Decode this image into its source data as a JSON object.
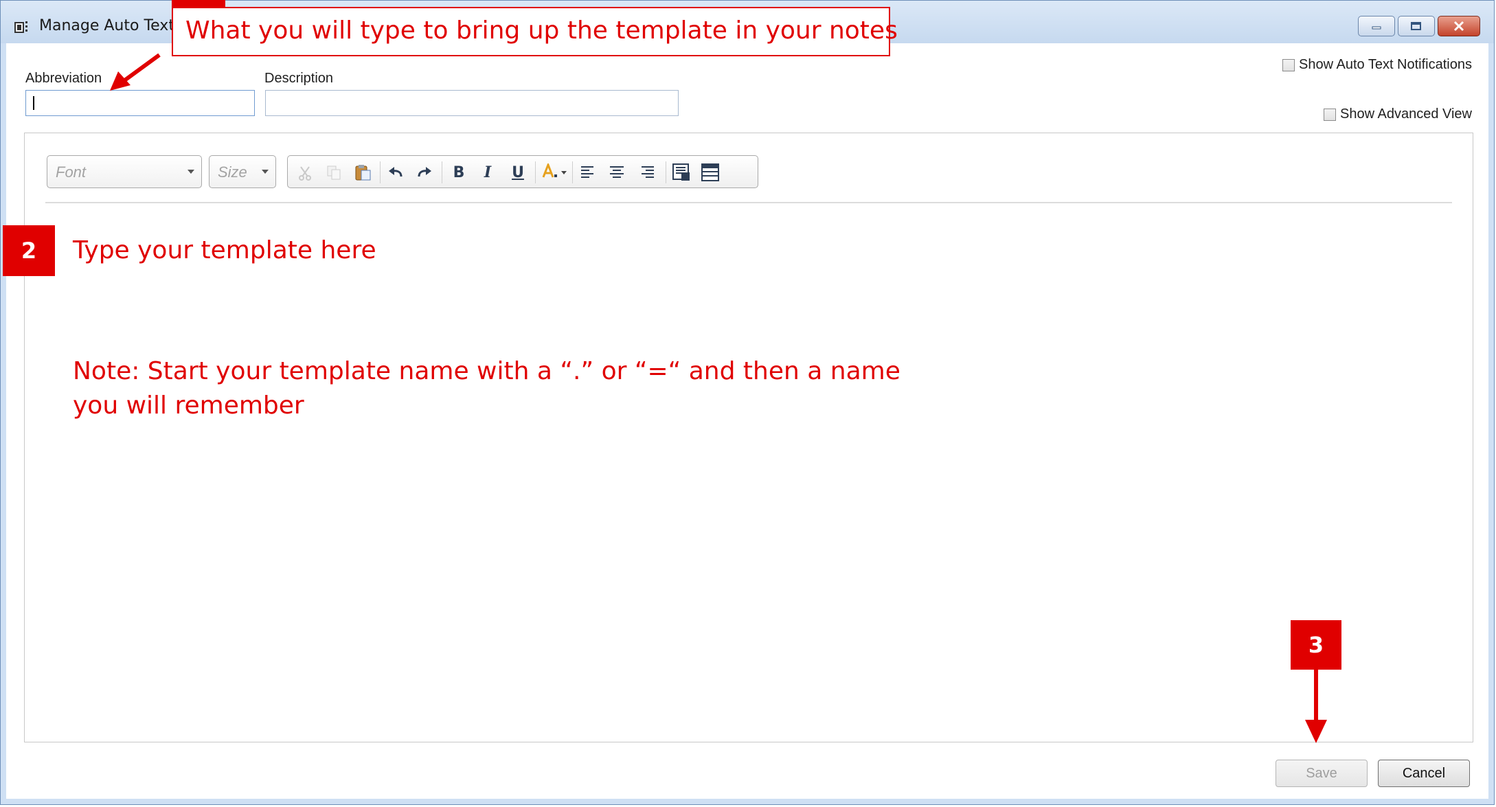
{
  "window": {
    "title": "Manage Auto Text",
    "controls": [
      "minimize",
      "maximize",
      "close"
    ]
  },
  "fields": {
    "abbreviation_label": "Abbreviation",
    "abbreviation_value": "",
    "description_label": "Description",
    "description_value": ""
  },
  "options": {
    "show_notifications_label": "Show Auto Text Notifications",
    "show_notifications_checked": false,
    "show_advanced_label": "Show Advanced View",
    "show_advanced_checked": false
  },
  "toolbar": {
    "font_placeholder": "Font",
    "size_placeholder": "Size",
    "icons": [
      "cut-icon",
      "copy-icon",
      "paste-icon",
      "undo-icon",
      "redo-icon",
      "bold-icon",
      "italic-icon",
      "underline-icon",
      "font-color-icon",
      "align-left-icon",
      "align-center-icon",
      "align-right-icon",
      "insert-template-icon",
      "insert-table-icon"
    ],
    "bold_glyph": "B",
    "italic_glyph": "I",
    "underline_glyph": "U"
  },
  "buttons": {
    "save_label": "Save",
    "cancel_label": "Cancel"
  },
  "annotations": {
    "callout_1": "What you will type to bring up the template in your notes",
    "badge_2": "2",
    "callout_2": "Type your template here",
    "note_line_1": "Note: Start your template name with a “.” or “=“ and then a name",
    "note_line_2": "you will remember",
    "badge_3": "3",
    "accent_color": "#e00000"
  }
}
